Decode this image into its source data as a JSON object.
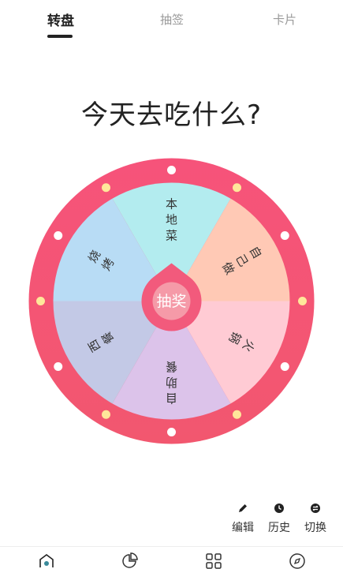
{
  "tabs": [
    {
      "label": "转盘",
      "active": true
    },
    {
      "label": "抽签",
      "active": false
    },
    {
      "label": "卡片",
      "active": false
    }
  ],
  "question": "今天去吃什么?",
  "wheel": {
    "center_label": "抽奖",
    "segments": [
      {
        "label": "本地菜",
        "color": "#b3ecef"
      },
      {
        "label": "自己做",
        "color": "#ffc9b5"
      },
      {
        "label": "火锅",
        "color": "#ffcbd4"
      },
      {
        "label": "自助餐",
        "color": "#dcc3ea"
      },
      {
        "label": "西餐",
        "color": "#c3c9e6"
      },
      {
        "label": "烧烤",
        "color": "#b8dcf5"
      }
    ],
    "ring_color": "#f25a7c",
    "center_color": "#f25a7c",
    "center_inner_color": "#f59aa8"
  },
  "actions": [
    {
      "label": "编辑",
      "icon": "pencil-icon"
    },
    {
      "label": "历史",
      "icon": "clock-icon"
    },
    {
      "label": "切换",
      "icon": "switch-icon"
    }
  ],
  "bottom_nav": [
    {
      "icon": "home-icon",
      "active": true
    },
    {
      "icon": "pie-chart-icon",
      "active": false
    },
    {
      "icon": "grid-icon",
      "active": false
    },
    {
      "icon": "compass-icon",
      "active": false
    }
  ]
}
